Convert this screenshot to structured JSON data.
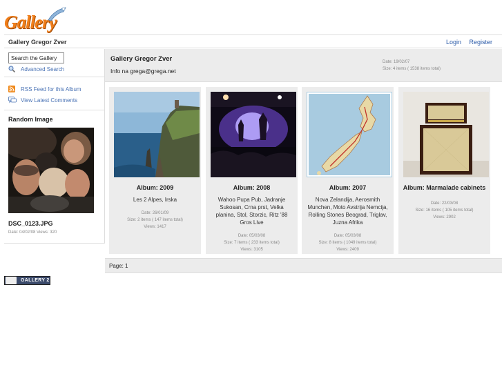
{
  "logo": {
    "text": "Gallery"
  },
  "header": {
    "site_title": "Gallery Gregor Zver",
    "login_label": "Login",
    "register_label": "Register"
  },
  "sidebar": {
    "search_value": "Search the Gallery",
    "advanced_search_label": "Advanced Search",
    "rss_label": "RSS Feed for this Album",
    "comments_label": "View Latest Comments",
    "random_image_title": "Random Image",
    "random_image_name": "DSC_0123.JPG",
    "random_image_meta": "Date: 04/02/08 Views: 320"
  },
  "album": {
    "title": "Gallery Gregor Zver",
    "description": "Info na grega@grega.net",
    "date": "Date: 19/02/07",
    "size": "Size: 4 items ( 1538 items total)"
  },
  "albums": [
    {
      "name": "Album: 2009",
      "description": "Les 2 Alpes, Irska",
      "date": "Date: 26/01/09",
      "size": "Size: 2 items ( 147 items total)",
      "views": "Views: 1417",
      "thumb": "cliffs-photo"
    },
    {
      "name": "Album: 2008",
      "description": "Wahoo Pupa Pub, Jadranje Sukosan, Crna prst, Velka planina, Stol, Storzic, Ritz '88 Gros Live",
      "date": "Date: 05/03/08",
      "size": "Size: 7 items ( 233 items total)",
      "views": "Views: 3105",
      "thumb": "concert-photo"
    },
    {
      "name": "Album: 2007",
      "description": "Nova Zelandija, Aerosmith Munchen, Moto Avstrija Nemcija, Rolling Stones Beograd, Triglav, Juzna Afrika",
      "date": "Date: 05/03/08",
      "size": "Size: 8 items ( 1049 items total)",
      "views": "Views: 2409",
      "thumb": "map-photo"
    },
    {
      "name": "Album: Marmalade cabinets",
      "description": "",
      "date": "Date: 22/03/08",
      "size": "Size: 16 items ( 105 items total)",
      "views": "Views: 2902",
      "thumb": "amplifier-photo"
    }
  ],
  "pager": {
    "label": "Page:",
    "current": "1"
  },
  "footer": {
    "badge_text": "GALLERY 2"
  },
  "colors": {
    "brand": "#f07e1a",
    "link": "#2a5aa8",
    "panel": "#ececec"
  }
}
